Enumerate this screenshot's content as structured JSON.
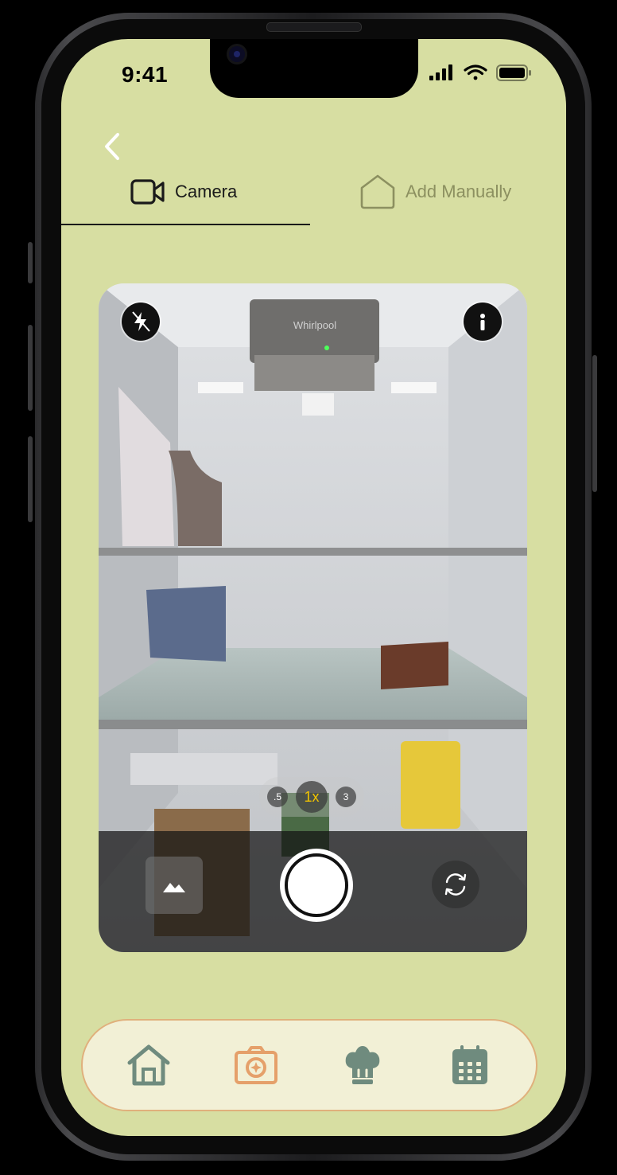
{
  "status_bar": {
    "time": "9:41",
    "icons": [
      "cellular-signal-icon",
      "wifi-icon",
      "battery-icon"
    ]
  },
  "header": {
    "back_icon": "chevron-left-icon"
  },
  "tabs": [
    {
      "label": "Camera",
      "icon": "video-camera-icon",
      "active": true
    },
    {
      "label": "Add Manually",
      "icon": "house-outline-icon",
      "active": false
    }
  ],
  "camera": {
    "flash_icon": "flash-off-icon",
    "info_icon": "info-icon",
    "zoom_levels": [
      ".5",
      "1x",
      "3"
    ],
    "selected_zoom": "1x",
    "gallery_icon": "gallery-mountain-icon",
    "shutter_icon": "shutter-button",
    "flip_icon": "flip-camera-icon",
    "preview_brand_text": "Whirlpool"
  },
  "bottom_nav": [
    {
      "icon": "home-icon",
      "active": false
    },
    {
      "icon": "camera-icon",
      "active": true
    },
    {
      "icon": "chef-hat-icon",
      "active": false
    },
    {
      "icon": "calendar-icon",
      "active": false
    }
  ],
  "colors": {
    "screen_bg": "#d7dea2",
    "nav_bg": "#f2f0d6",
    "nav_border": "#e0b07c",
    "nav_icon": "#6f8b7e",
    "nav_active": "#e5a06a",
    "tab_inactive": "#8c9060",
    "zoom_active": "#f2c400"
  }
}
